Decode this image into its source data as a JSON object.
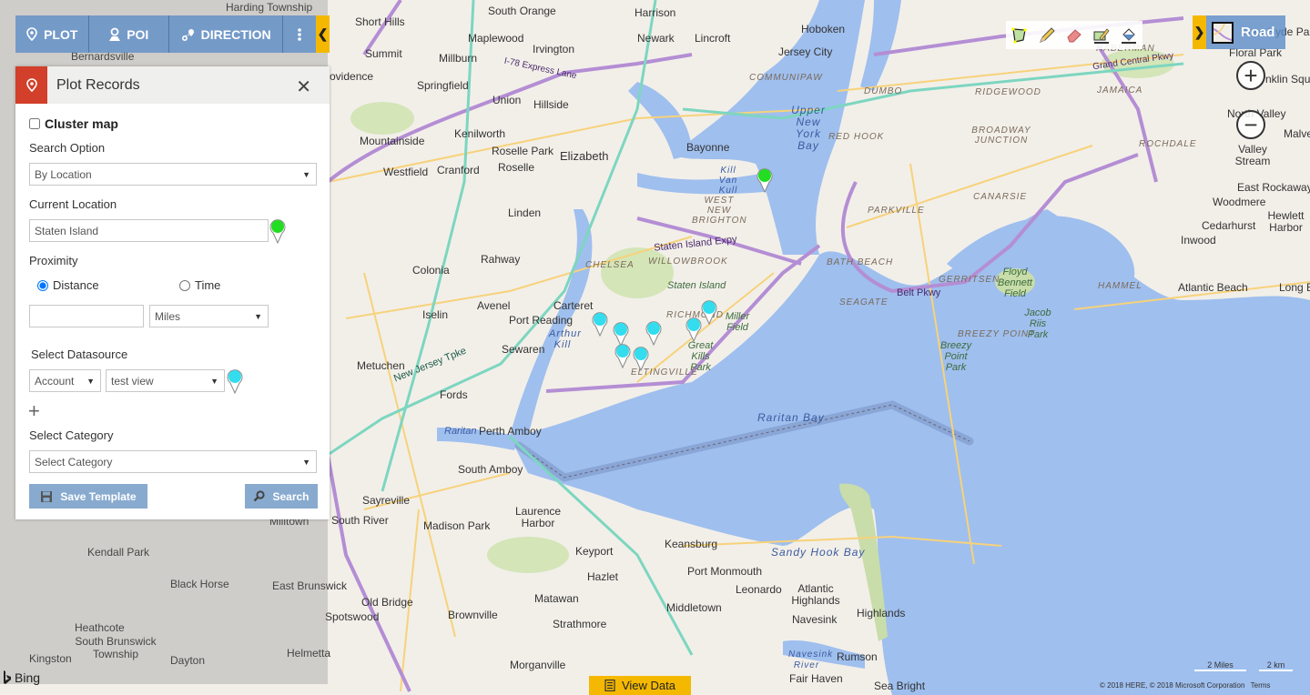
{
  "toolbar": {
    "plot_label": "PLOT",
    "poi_label": "POI",
    "direction_label": "DIRECTION",
    "collapse_icon": "chevron-left-icon"
  },
  "panel": {
    "title": "Plot Records",
    "cluster_label": "Cluster map",
    "cluster_checked": false,
    "search_option_label": "Search Option",
    "search_option_value": "By Location",
    "current_location_label": "Current Location",
    "current_location_value": "Staten Island",
    "current_location_pin_color": "#22dd22",
    "proximity_label": "Proximity",
    "radio_distance": "Distance",
    "radio_time": "Time",
    "radio_selected": "Distance",
    "proximity_value": "",
    "unit_value": "Miles",
    "datasource_label": "Select Datasource",
    "datasource_entity": "Account",
    "datasource_view": "test view",
    "datasource_pin_color": "#33dded",
    "add_icon": "plus-icon",
    "category_label": "Select Category",
    "category_placeholder": "Select Category",
    "save_template_label": "Save Template",
    "search_label": "Search"
  },
  "map_controls": {
    "road_label": "Road",
    "zoom_in": "+",
    "zoom_out": "−",
    "view_data_label": "View Data",
    "scale_miles": "2 Miles",
    "scale_km": "2 km",
    "copyright": "© 2018 HERE, © 2018 Microsoft Corporation",
    "terms": "Terms",
    "provider": "Bing"
  },
  "colors": {
    "accent_blue": "#5a8cc8",
    "accent_yellow": "#f5b800",
    "panel_badge_red": "#d23f2a",
    "water": "#9fbfee",
    "land": "#f2efe9",
    "park": "#c8ddaa",
    "highway": "#b48ed4",
    "toll": "#7dd6c0",
    "arterial": "#f7d27a"
  },
  "map": {
    "pins": [
      {
        "name": "current-location",
        "color": "#22dd22"
      },
      {
        "name": "record",
        "color": "#33dded"
      },
      {
        "name": "record",
        "color": "#33dded"
      },
      {
        "name": "record",
        "color": "#33dded"
      },
      {
        "name": "record",
        "color": "#33dded"
      },
      {
        "name": "record",
        "color": "#33dded"
      },
      {
        "name": "record",
        "color": "#33dded"
      },
      {
        "name": "record",
        "color": "#33dded"
      }
    ],
    "labels": {
      "harding": "Harding Township",
      "short_hills": "Short Hills",
      "south_orange": "South Orange",
      "harrison": "Harrison",
      "newark": "Newark",
      "lincroft": "Lincroft",
      "hoboken": "Hoboken",
      "jersey_city": "Jersey City",
      "maplewood": "Maplewood",
      "irvington": "Irvington",
      "summit": "Summit",
      "millburn": "Millburn",
      "bernardsville": "Bernardsville",
      "providence": "ovidence",
      "springfield": "Springfield",
      "union": "Union",
      "hillside": "Hillside",
      "mountainside": "Mountainside",
      "kenilworth": "Kenilworth",
      "roselle_park": "Roselle Park",
      "roselle": "Roselle",
      "elizabeth": "Elizabeth",
      "westfield": "Westfield",
      "cranford": "Cranford",
      "bayonne": "Bayonne",
      "linden": "Linden",
      "rahway": "Rahway",
      "colonia": "Colonia",
      "avenel": "Avenel",
      "iselin": "Iselin",
      "carteret": "Carteret",
      "port_reading": "Port Reading",
      "sewaren": "Sewaren",
      "metuchen": "Metuchen",
      "fords": "Fords",
      "perth_amboy": "Perth Amboy",
      "south_amboy": "South Amboy",
      "sayreville": "Sayreville",
      "south_river": "South River",
      "madison_park": "Madison Park",
      "laurence_harbor": "Laurence Harbor",
      "keyport": "Keyport",
      "keansburg": "Keansburg",
      "hazlet": "Hazlet",
      "port_monmouth": "Port Monmouth",
      "leonardo": "Leonardo",
      "atlantic_highlands": "Atlantic Highlands",
      "highlands": "Highlands",
      "matawan": "Matawan",
      "middletown": "Middletown",
      "navesink": "Navesink",
      "old_bridge": "Old Bridge",
      "brownville": "Brownville",
      "strathmore": "Strathmore",
      "spotswood": "Spotswood",
      "morganville": "Morganville",
      "rumson": "Rumson",
      "fair_haven": "Fair Haven",
      "sea_bright": "Sea Bright",
      "milltown": "Milltown",
      "kendall_park": "Kendall Park",
      "black_horse": "Black Horse",
      "east_brunswick": "East Brunswick",
      "heathcote": "Heathcote",
      "south_brunswick": "South Brunswick Township",
      "kingston": "Kingston",
      "dayton": "Dayton",
      "helmetta": "Helmetta",
      "floral_park": "Floral Park",
      "new_hyde_park": "New Hyde Park",
      "franklin_square": "nklin Square",
      "north_valley": "North Valley",
      "malverne": "Malve",
      "valley_stream": "Valley Stream",
      "east_rockaway": "East Rockaway",
      "woodmere": "Woodmere",
      "hewlett_harbor": "Hewlett Harbor",
      "cedarhurst": "Cedarhurst",
      "inwood": "Inwood",
      "atlantic_beach": "Atlantic Beach",
      "long_beach": "Long Be",
      "staten_island": "Staten Island",
      "upper_ny_bay": "Upper New York Bay",
      "kill_van_kull": "Kill Van Kull",
      "arthur_kill": "Arthur Kill",
      "raritan": "Raritan",
      "raritan_bay": "Raritan Bay",
      "sandy_hook_bay": "Sandy Hook Bay",
      "navesink_river": "Navesink River",
      "communipaw": "COMMUNIPAW",
      "dumbo": "DUMBO",
      "red_hook": "RED HOOK",
      "ridgewood": "RIDGEWOOD",
      "jamaica": "JAMAICA",
      "broadway_junction": "BROADWAY JUNCTION",
      "rochdale": "ROCHDALE",
      "haberman": "HABERMAN",
      "parkville": "PARKVILLE",
      "canarsie": "CANARSIE",
      "bath_beach": "BATH BEACH",
      "gerritsen": "GERRITSEN",
      "seagate": "SEAGATE",
      "hammel": "HAMMEL",
      "breezy_point": "BREEZY POINT",
      "west_new_brighton": "WEST NEW BRIGHTON",
      "willowbrook": "WILLOWBROOK",
      "chelsea": "CHELSEA",
      "richmond": "RICHMOND",
      "eltingville": "ELTINGVILLE",
      "floyd_bennett": "Floyd Bennett Field",
      "jacob_riis": "Jacob Riis Park",
      "breezy_park": "Breezy Point Park",
      "miller_field": "Miller Field",
      "great_kills": "Great Kills Park",
      "belt_pkwy": "Belt Pkwy",
      "si_expy": "Staten Island Expy",
      "nj_tpke": "New Jersey Tpke",
      "grand_central": "Grand Central Pkwy",
      "i78_express": "I-78 Express Lane"
    }
  }
}
